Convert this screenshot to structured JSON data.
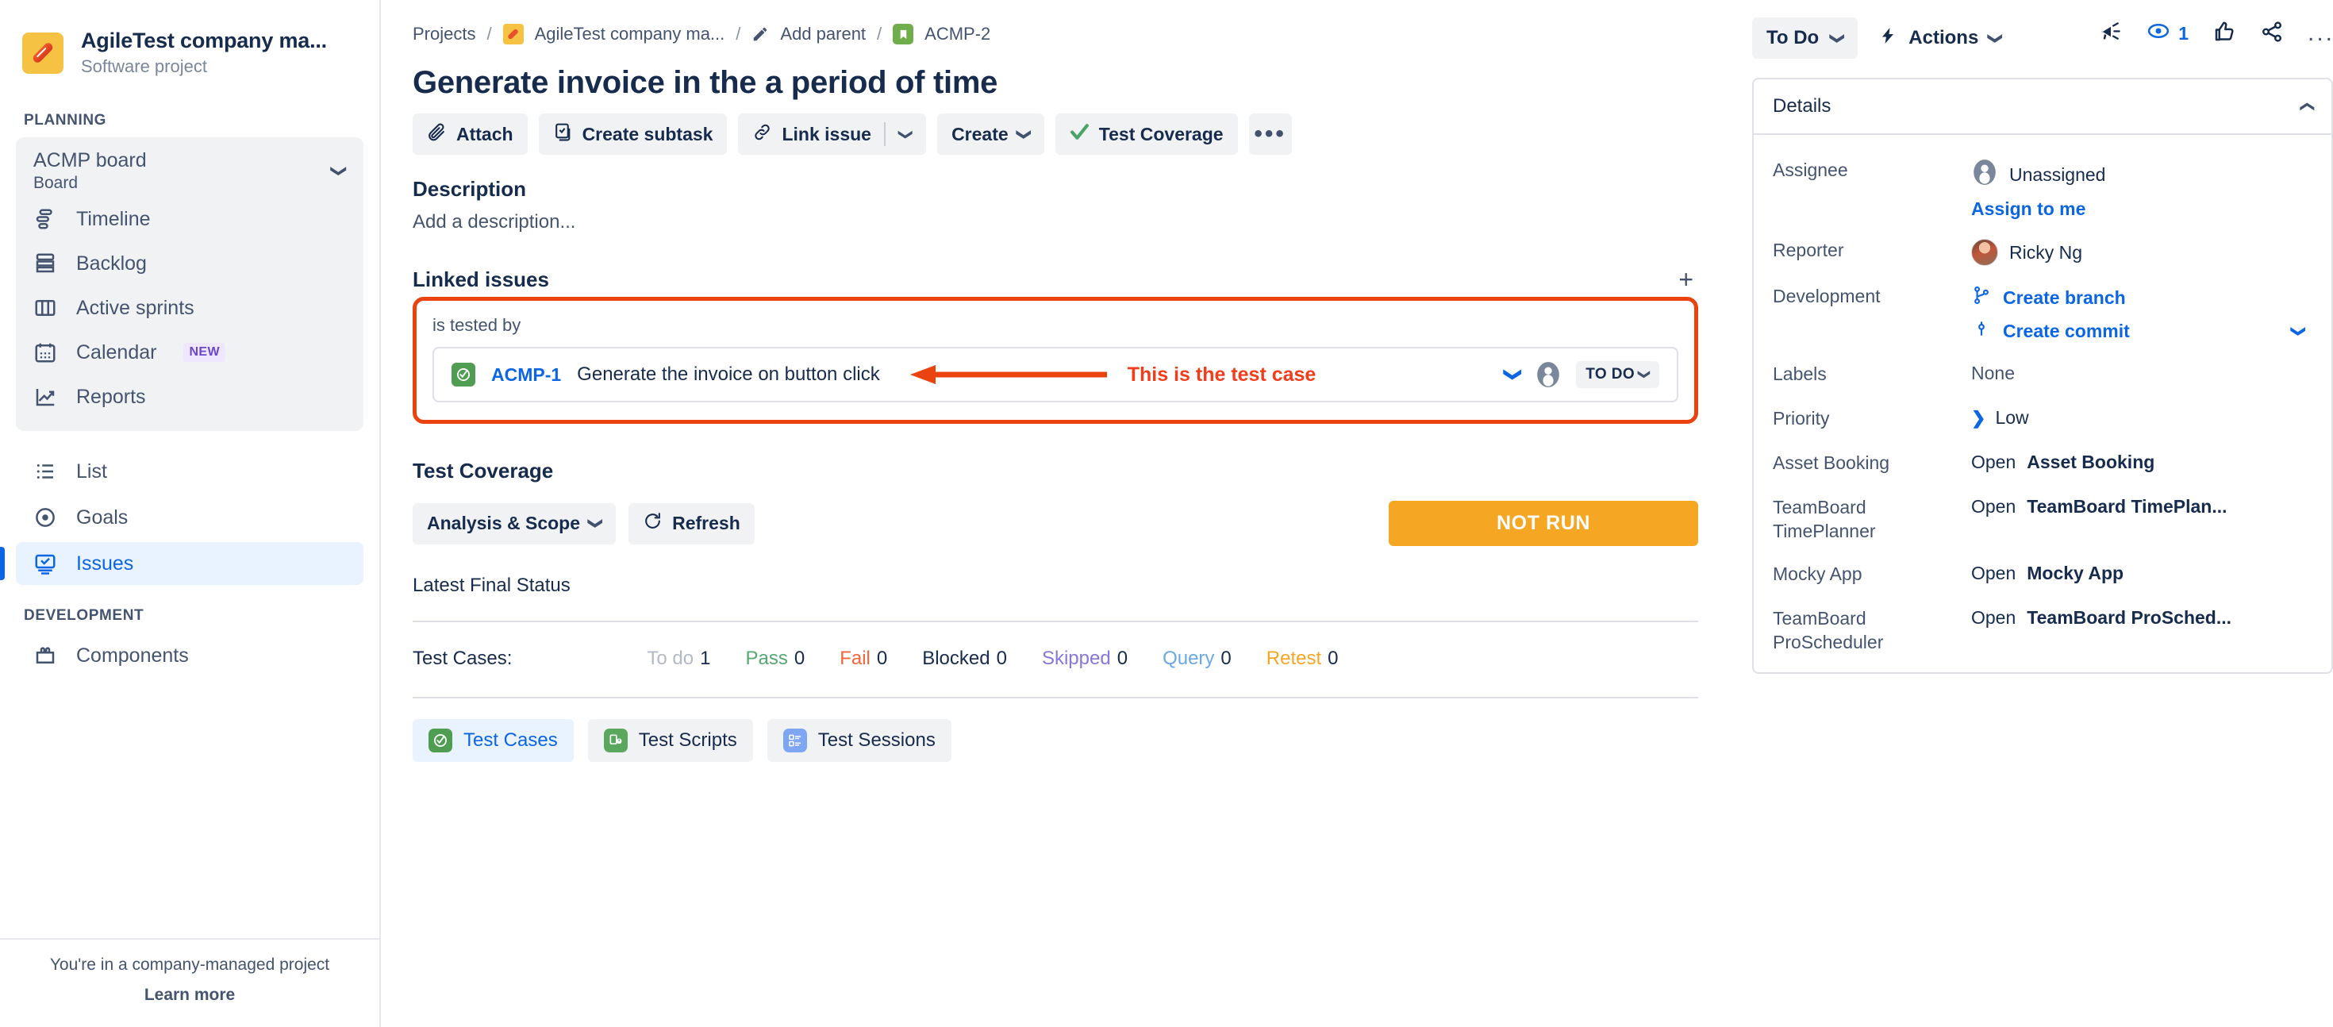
{
  "sidebar": {
    "project_name": "AgileTest company ma...",
    "project_type": "Software project",
    "planning_label": "PLANNING",
    "board": {
      "name": "ACMP board",
      "subtitle": "Board"
    },
    "board_items": [
      {
        "label": "Timeline",
        "icon": "timeline-icon"
      },
      {
        "label": "Backlog",
        "icon": "backlog-icon"
      },
      {
        "label": "Active sprints",
        "icon": "board-columns-icon"
      },
      {
        "label": "Calendar",
        "icon": "calendar-icon",
        "badge": "NEW"
      },
      {
        "label": "Reports",
        "icon": "reports-icon"
      }
    ],
    "plain_items": [
      {
        "label": "List",
        "icon": "list-icon",
        "active": false
      },
      {
        "label": "Goals",
        "icon": "goals-icon",
        "active": false
      },
      {
        "label": "Issues",
        "icon": "issues-icon",
        "active": true
      }
    ],
    "development_label": "DEVELOPMENT",
    "dev_items": [
      {
        "label": "Components",
        "icon": "components-icon"
      }
    ],
    "footer_note": "You're in a company-managed project",
    "footer_link": "Learn more"
  },
  "breadcrumb": {
    "projects": "Projects",
    "project": "AgileTest company ma...",
    "add_parent": "Add parent",
    "issue_key": "ACMP-2",
    "separator": "/"
  },
  "header_icons": {
    "feedback": "megaphone-icon",
    "watchers_count": "1",
    "like": "thumbs-up-icon",
    "share": "share-icon",
    "more": "..."
  },
  "issue": {
    "title": "Generate invoice in the a period of time"
  },
  "toolbar": {
    "attach": "Attach",
    "create_subtask": "Create subtask",
    "link_issue": "Link issue",
    "create": "Create",
    "test_coverage": "Test Coverage",
    "more": "•••"
  },
  "description": {
    "heading": "Description",
    "placeholder": "Add a description..."
  },
  "linked_issues": {
    "heading": "Linked issues",
    "add": "+",
    "relation": "is tested by",
    "row": {
      "key": "ACMP-1",
      "summary": "Generate the invoice on button click",
      "status": "TO DO"
    },
    "annotation": "This is the test case"
  },
  "test_coverage": {
    "heading": "Test Coverage",
    "scope_select": "Analysis & Scope",
    "refresh": "Refresh",
    "status_badge": "NOT RUN",
    "latest_final_status": "Latest Final Status",
    "counts_label": "Test Cases:",
    "counts": [
      {
        "label": "To do",
        "value": "1",
        "color": "#B3BAC5"
      },
      {
        "label": "Pass",
        "value": "0",
        "color": "#57A773"
      },
      {
        "label": "Fail",
        "value": "0",
        "color": "#F2653A"
      },
      {
        "label": "Blocked",
        "value": "0",
        "color": "#172B4D"
      },
      {
        "label": "Skipped",
        "value": "0",
        "color": "#8777D9"
      },
      {
        "label": "Query",
        "value": "0",
        "color": "#6BA8E5"
      },
      {
        "label": "Retest",
        "value": "0",
        "color": "#F5A623"
      }
    ],
    "tabs": [
      {
        "label": "Test Cases",
        "icon": "test-cases-icon",
        "active": true
      },
      {
        "label": "Test Scripts",
        "icon": "test-scripts-icon",
        "active": false
      },
      {
        "label": "Test Sessions",
        "icon": "test-sessions-icon",
        "active": false
      }
    ]
  },
  "right_panel": {
    "status": "To Do",
    "actions": "Actions",
    "details_heading": "Details",
    "fields": [
      {
        "label": "Assignee",
        "value": "Unassigned",
        "type": "avatar-unassigned",
        "extra": "Assign to me"
      },
      {
        "label": "Reporter",
        "value": "Ricky Ng",
        "type": "avatar-photo"
      },
      {
        "label": "Development",
        "value": "Create branch",
        "type": "dev",
        "extra": "Create commit"
      },
      {
        "label": "Labels",
        "value": "None",
        "type": "muted"
      },
      {
        "label": "Priority",
        "value": "Low",
        "type": "priority"
      },
      {
        "label": "Asset Booking",
        "value": "Open",
        "bold": "Asset Booking",
        "type": "open"
      },
      {
        "label": "TeamBoard TimePlanner",
        "value": "Open",
        "bold": "TeamBoard TimePlan...",
        "type": "open"
      },
      {
        "label": "Mocky App",
        "value": "Open",
        "bold": "Mocky App",
        "type": "open"
      },
      {
        "label": "TeamBoard ProScheduler",
        "value": "Open",
        "bold": "TeamBoard ProSched...",
        "type": "open"
      }
    ]
  },
  "colors": {
    "accent": "#0C66E4",
    "annotation_red": "#EA4310",
    "not_run_orange": "#F5A623",
    "project_avatar": "#F6C244"
  }
}
